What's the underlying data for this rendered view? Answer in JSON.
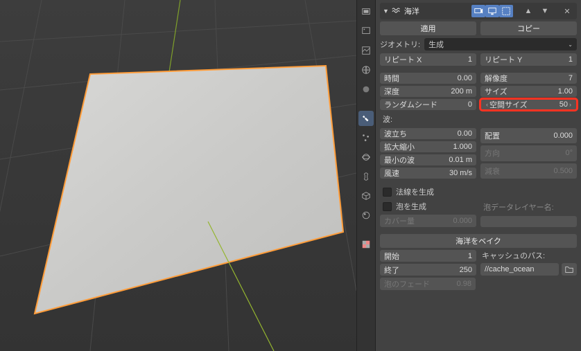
{
  "modifier": {
    "type_icon": "waves",
    "name": "海洋",
    "display_modes": {
      "realtime": true,
      "render": true,
      "edit": true
    },
    "apply_label": "適用",
    "copy_label": "コピー"
  },
  "geometry": {
    "label": "ジオメトリ:",
    "mode": "生成",
    "repeat_x": {
      "label": "リピート X",
      "value": "1"
    },
    "repeat_y": {
      "label": "リピート Y",
      "value": "1"
    }
  },
  "left_fields": {
    "time": {
      "label": "時間",
      "value": "0.00"
    },
    "depth": {
      "label": "深度",
      "value": "200 m"
    },
    "seed": {
      "label": "ランダムシード",
      "value": "0"
    }
  },
  "right_fields": {
    "resolution": {
      "label": "解像度",
      "value": "7"
    },
    "size": {
      "label": "サイズ",
      "value": "1.00"
    },
    "spatial_size": {
      "label": "空間サイズ",
      "value": "50"
    }
  },
  "wave_section": {
    "header": "波:",
    "choppiness": {
      "label": "波立ち",
      "value": "0.00"
    },
    "scale": {
      "label": "拡大縮小",
      "value": "1.000"
    },
    "smallest_wave": {
      "label": "最小の波",
      "value": "0.01 m"
    },
    "wind_velocity": {
      "label": "風速",
      "value": "30 m/s"
    },
    "alignment": {
      "label": "配置",
      "value": "0.000"
    },
    "direction": {
      "label": "方向",
      "value": "0°"
    },
    "damping": {
      "label": "減衰",
      "value": "0.500"
    }
  },
  "foam": {
    "generate_normals": {
      "label": "法線を生成",
      "checked": false
    },
    "generate_foam": {
      "label": "泡を生成",
      "checked": false
    },
    "coverage": {
      "label": "カバー量",
      "value": "0.000"
    },
    "foam_layer_label": "泡データレイヤー名:"
  },
  "bake": {
    "button": "海洋をベイク",
    "frame_start": {
      "label": "開始",
      "value": "1"
    },
    "frame_end": {
      "label": "終了",
      "value": "250"
    },
    "cache_label": "キャッシュのパス:",
    "cache_path": "//cache_ocean",
    "foam_fade": {
      "label": "泡のフェード",
      "value": "0.98"
    }
  },
  "tool_strip": [
    "printer",
    "settings",
    "image",
    "globe",
    "sphere",
    "wrench",
    "particles",
    "physics",
    "constraint",
    "mesh",
    "material",
    "texture-checker"
  ]
}
